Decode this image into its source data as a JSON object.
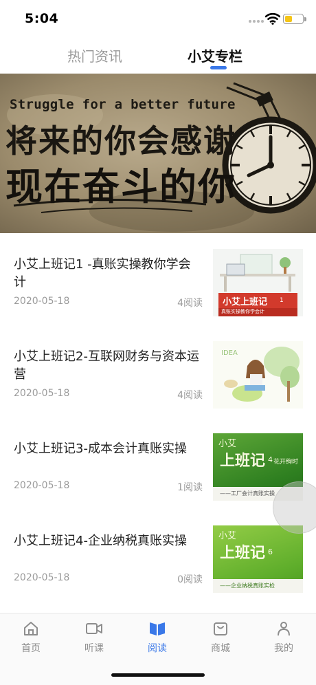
{
  "status_bar": {
    "time": "5:04",
    "battery_color": "#f5c518"
  },
  "tabs": [
    {
      "label": "热门资讯",
      "active": false
    },
    {
      "label": "小艾专栏",
      "active": true
    }
  ],
  "accent_color": "#3a78e8",
  "banner": {
    "english": "Struggle for a better future",
    "line1": "将来的你会感谢",
    "line2": "现在奋斗的你"
  },
  "articles": [
    {
      "title": "小艾上班记1 -真账实操教你学会计",
      "date": "2020-05-18",
      "reads": "4阅读",
      "thumb": {
        "title": "小艾上班记",
        "num": "1",
        "subtitle": "真账实操教你学会计"
      }
    },
    {
      "title": "小艾上班记2-互联网财务与资本运营",
      "date": "2020-05-18",
      "reads": "4阅读",
      "thumb": {
        "title": "",
        "num": "",
        "subtitle": ""
      }
    },
    {
      "title": "小艾上班记3-成本会计真账实操",
      "date": "2020-05-18",
      "reads": "1阅读",
      "thumb": {
        "top": "小艾",
        "title": "上班记",
        "num": "4",
        "extra": "花开绚时",
        "subtitle": "——工厂会计真账实操"
      }
    },
    {
      "title": "小艾上班记4-企业纳税真账实操",
      "date": "2020-05-18",
      "reads": "0阅读",
      "thumb": {
        "top": "小艾",
        "title": "上班记",
        "num": "6",
        "subtitle": "——企业纳税真账实检"
      }
    }
  ],
  "bottom_nav": [
    {
      "label": "首页",
      "icon": "home-icon",
      "active": false
    },
    {
      "label": "听课",
      "icon": "video-camera-icon",
      "active": false
    },
    {
      "label": "阅读",
      "icon": "open-book-icon",
      "active": true
    },
    {
      "label": "商城",
      "icon": "shopping-bag-icon",
      "active": false
    },
    {
      "label": "我的",
      "icon": "person-icon",
      "active": false
    }
  ]
}
